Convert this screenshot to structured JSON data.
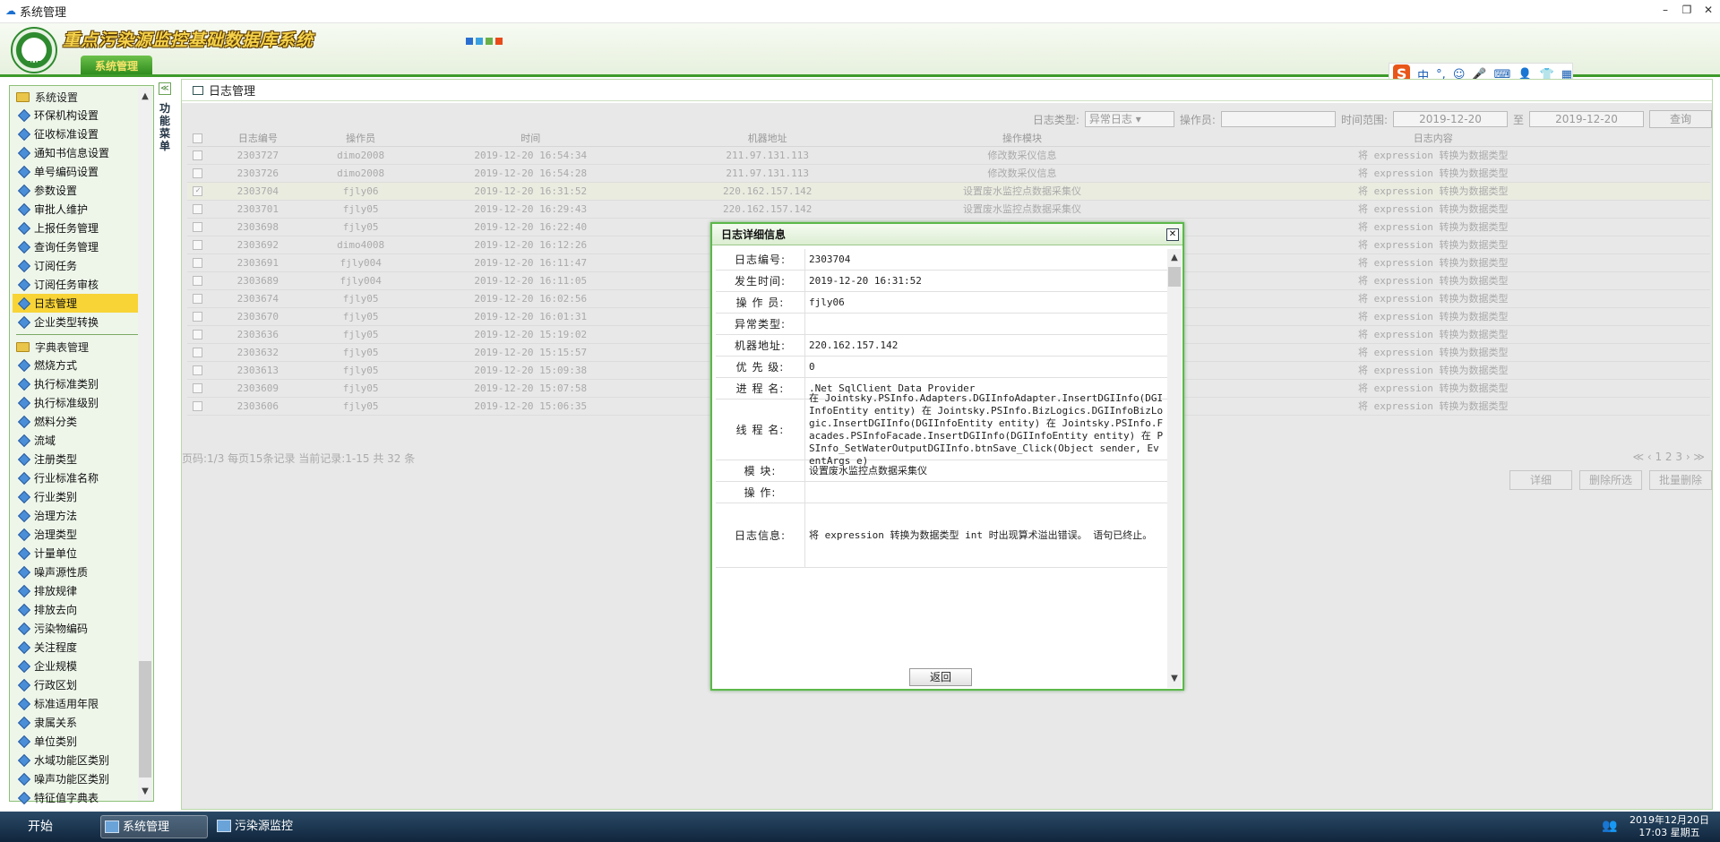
{
  "window": {
    "title": "系统管理",
    "controls": [
      "–",
      "❐",
      "✕"
    ]
  },
  "header": {
    "system_name": "重点污染源监控基础数据库系统",
    "logo_text": "ZHB",
    "main_tab": "系统管理",
    "theme_colors": [
      "#2a6fd0",
      "#3aa0e0",
      "#6ab04a",
      "#e84a1a"
    ]
  },
  "ime": {
    "logo": "S",
    "lang": "中",
    "icons": [
      "°,",
      "☺",
      "🎤",
      "⌨",
      "👤",
      "👕",
      "▦"
    ]
  },
  "sidebar": {
    "group1": {
      "label": "系统设置",
      "items": [
        "环保机构设置",
        "征收标准设置",
        "通知书信息设置",
        "单号编码设置",
        "参数设置",
        "审批人维护",
        "上报任务管理",
        "查询任务管理",
        "订阅任务",
        "订阅任务审核",
        "日志管理",
        "企业类型转换"
      ]
    },
    "group2": {
      "label": "字典表管理",
      "items": [
        "燃烧方式",
        "执行标准类别",
        "执行标准级别",
        "燃料分类",
        "流域",
        "注册类型",
        "行业标准名称",
        "行业类别",
        "治理方法",
        "治理类型",
        "计量单位",
        "噪声源性质",
        "排放规律",
        "排放去向",
        "污染物编码",
        "关注程度",
        "企业规模",
        "行政区划",
        "标准适用年限",
        "隶属关系",
        "单位类别",
        "水域功能区类别",
        "噪声功能区类别",
        "特征值字典表"
      ]
    },
    "active": "日志管理",
    "collapse_arrow": "≪",
    "menu_label": "功能菜单"
  },
  "panel": {
    "title": "日志管理",
    "filter": {
      "type_label": "日志类型:",
      "type_value": "异常日志",
      "operator_label": "操作员:",
      "operator_value": "",
      "range_label": "时间范围:",
      "date_from": "2019-12-20",
      "to": "至",
      "date_to": "2019-12-20",
      "query": "查询"
    },
    "columns": [
      "日志编号",
      "操作员",
      "时间",
      "机器地址",
      "操作模块",
      "日志内容"
    ],
    "rows": [
      [
        "2303727",
        "dimo2008",
        "2019-12-20 16:54:34",
        "211.97.131.113",
        "修改数采仪信息",
        "将 expression 转换为数据类型"
      ],
      [
        "2303726",
        "dimo2008",
        "2019-12-20 16:54:28",
        "211.97.131.113",
        "修改数采仪信息",
        "将 expression 转换为数据类型"
      ],
      [
        "2303704",
        "fjly06",
        "2019-12-20 16:31:52",
        "220.162.157.142",
        "设置废水监控点数据采集仪",
        "将 expression 转换为数据类型"
      ],
      [
        "2303701",
        "fjly05",
        "2019-12-20 16:29:43",
        "220.162.157.142",
        "设置废水监控点数据采集仪",
        "将 expression 转换为数据类型"
      ],
      [
        "2303698",
        "fjly05",
        "2019-12-20 16:22:40",
        "",
        "数据采集仪",
        "将 expression 转换为数据类型"
      ],
      [
        "2303692",
        "dimo4008",
        "2019-12-20 16:12:26",
        "",
        "数据采集仪",
        "将 expression 转换为数据类型"
      ],
      [
        "2303691",
        "fjly004",
        "2019-12-20 16:11:47",
        "",
        "数据采集仪",
        "将 expression 转换为数据类型"
      ],
      [
        "2303689",
        "fjly004",
        "2019-12-20 16:11:05",
        "",
        "数据采集仪",
        "将 expression 转换为数据类型"
      ],
      [
        "2303674",
        "fjly05",
        "2019-12-20 16:02:56",
        "",
        "数据采集仪",
        "将 expression 转换为数据类型"
      ],
      [
        "2303670",
        "fjly05",
        "2019-12-20 16:01:31",
        "",
        "数据采集仪",
        "将 expression 转换为数据类型"
      ],
      [
        "2303636",
        "fjly05",
        "2019-12-20 15:19:02",
        "",
        "数据采集仪",
        "将 expression 转换为数据类型"
      ],
      [
        "2303632",
        "fjly05",
        "2019-12-20 15:15:57",
        "",
        "数据采集仪",
        "将 expression 转换为数据类型"
      ],
      [
        "2303613",
        "fjly05",
        "2019-12-20 15:09:38",
        "",
        "数据采集仪",
        "将 expression 转换为数据类型"
      ],
      [
        "2303609",
        "fjly05",
        "2019-12-20 15:07:58",
        "",
        "数据采集仪",
        "将 expression 转换为数据类型"
      ],
      [
        "2303606",
        "fjly05",
        "2019-12-20 15:06:35",
        "",
        "数据采集仪",
        "将 expression 转换为数据类型"
      ]
    ],
    "page_info": "页码:1/3 每页15条记录  当前记录:1-15 共 32 条",
    "pager": "≪ ‹ 1 2 3 › ≫",
    "buttons": {
      "detail": "详细",
      "delete_selected": "删除所选",
      "batch_delete": "批量删除"
    }
  },
  "dialog": {
    "title": "日志详细信息",
    "close": "✕",
    "fields": [
      {
        "k": "日志编号:",
        "v": "2303704"
      },
      {
        "k": "发生时间:",
        "v": "2019-12-20 16:31:52"
      },
      {
        "k": "操 作 员:",
        "v": "fjly06"
      },
      {
        "k": "异常类型:",
        "v": ""
      },
      {
        "k": "机器地址:",
        "v": "220.162.157.142"
      },
      {
        "k": "优 先 级:",
        "v": "0"
      },
      {
        "k": "进 程 名:",
        "v": ".Net SqlClient Data Provider"
      },
      {
        "k": "线 程 名:",
        "v": "在 Jointsky.PSInfo.Adapters.DGIInfoAdapter.InsertDGIInfo(DGIInfoEntity entity) 在 Jointsky.PSInfo.BizLogics.DGIInfoBizLogic.InsertDGIInfo(DGIInfoEntity entity) 在 Jointsky.PSInfo.Facades.PSInfoFacade.InsertDGIInfo(DGIInfoEntity entity) 在 PSInfo_SetWaterOutputDGIInfo.btnSave_Click(Object sender, EventArgs e)"
      },
      {
        "k": "模 块:",
        "v": "设置废水监控点数据采集仪"
      },
      {
        "k": "操 作:",
        "v": ""
      },
      {
        "k": "日志信息:",
        "v": "将 expression 转换为数据类型 int 时出现算术溢出错误。 语句已终止。"
      }
    ],
    "back": "返回"
  },
  "taskbar": {
    "start": "开始",
    "tasks": [
      "系统管理",
      "污染源监控"
    ],
    "clock_date": "2019年12月20日",
    "clock_time": "17:03 星期五"
  }
}
